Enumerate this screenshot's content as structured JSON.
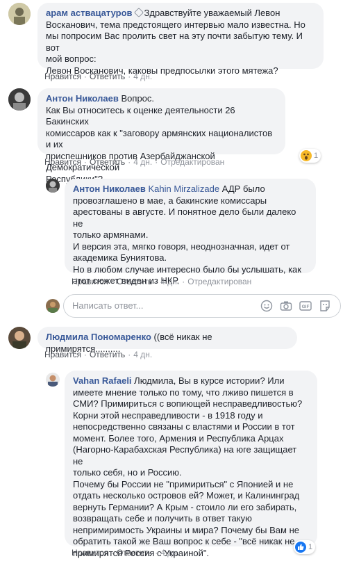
{
  "comments": [
    {
      "author": "арам аствацатуров",
      "lines": [
        "Здравствуйте уважаемый Левон",
        "Восканович, тема предстоящего интервью мало известна. Но",
        "мы попросим Вас пролить свет на эту почти забытую тему. И вот",
        "мой вопрос:",
        "Левон Восканович, каковы предпосылки этого мятежа?"
      ],
      "like": "Нравится",
      "reply": "Ответить",
      "time": "4 дн."
    },
    {
      "author": "Антон Николаев",
      "lines": [
        "Вопрос.",
        "Как Вы относитесь к оценке деятельности 26 Бакинских",
        "комиссаров как к \"заговору армянских националистов и их",
        "приспешников против Азербайджанской Демократической",
        "Республики\"?"
      ],
      "like": "Нравится",
      "reply": "Ответить",
      "time": "4 дн.",
      "edited": "Отредактирован",
      "reaction_count": "1",
      "reaction_icon": "wow-icon"
    },
    {
      "author": "Антон Николаев",
      "mention": "Kahin Mirzalizade",
      "lines": [
        "АДР было",
        "провозглашено в мае, а бакинские комиссары",
        "арестованы в августе. И понятное дело были далеко не",
        "только армянами.",
        "И версия эта, мягко говоря, неоднозначная, идет от",
        "академика Буниятова.",
        "Но в любом случае интересно было бы услышать, как",
        "этот сюжет виден из НКР."
      ],
      "like": "Нравится",
      "reply": "Ответить",
      "time": "4 дн.",
      "edited": "Отредактирован"
    },
    {
      "author": "Людмила Пономаренко",
      "lines": [
        "((всё никак не примирятся.........."
      ],
      "like": "Нравится",
      "reply": "Ответить",
      "time": "4 дн."
    },
    {
      "author": "Vahan Rafaeli",
      "lines": [
        "Людмила, Вы в курсе истории? Или",
        "имеете мнение только по тому, что лживо пишется в",
        "СМИ? Примириться с вопиющей несправедливостью?",
        "Корни этой несправедливости - в 1918 году и",
        "непосредственно связаны с властями и России в тот",
        "момент. Более того, Армения и Республика Арцах",
        "(Нагорно-Карабахская Республика) на юге защищает не",
        "только себя, но и Россию.",
        "Почему бы России не \"примириться\" с Японией и не",
        "отдать несколько островов ей? Может, и Калининград",
        "вернуть Германии? А Крым - стоило ли его забирать,",
        "возвращать себе и получить в ответ такую",
        "непримиримость Украины и мира? Почему бы Вам не",
        "обратить такой же Ваш вопрос к себе - \"всё никак не",
        "примирятся Россия с Украиной\"."
      ],
      "like": "Нравится",
      "reply": "Ответить",
      "time": "4 дн.",
      "reaction_count": "1",
      "reaction_icon": "like-icon"
    }
  ],
  "reply_box": {
    "placeholder": "Написать ответ...",
    "icons": [
      "emoji-icon",
      "camera-icon",
      "gif-icon",
      "sticker-icon"
    ]
  },
  "colors": {
    "author": "#385898",
    "bubble": "#f2f3f5",
    "meta": "#90949c",
    "like_blue": "#1877f2"
  }
}
